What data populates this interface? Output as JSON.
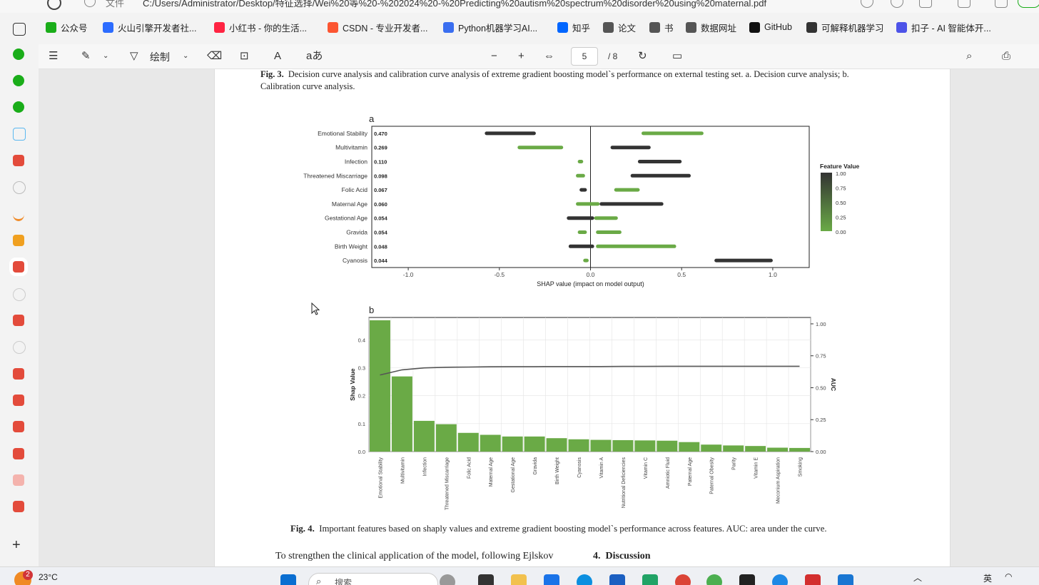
{
  "browser": {
    "file_label": "文件",
    "url": "C:/Users/Administrator/Desktop/特征选择/Wei%20等%20-%202024%20-%20Predicting%20autism%20spectrum%20disorder%20using%20maternal.pdf"
  },
  "bookmarks": [
    {
      "label": "公众号",
      "color": "#1aad19"
    },
    {
      "label": "火山引擎开发者社...",
      "color": "#2c6cff"
    },
    {
      "label": "小红书 - 你的生活...",
      "color": "#ff2442"
    },
    {
      "label": "CSDN - 专业开发者...",
      "color": "#fc5531"
    },
    {
      "label": "Python机器学习AI...",
      "color": "#3a6ef0"
    },
    {
      "label": "知乎",
      "color": "#0066ff"
    },
    {
      "label": "论文",
      "color": "#555555"
    },
    {
      "label": "书",
      "color": "#555555"
    },
    {
      "label": "数据网址",
      "color": "#555555"
    },
    {
      "label": "GitHub",
      "color": "#111111"
    },
    {
      "label": "可解释机器学习",
      "color": "#333333"
    },
    {
      "label": "扣子 - AI 智能体开...",
      "color": "#4d53e8"
    }
  ],
  "toolbar": {
    "draw_label": "绘制",
    "current_page": "5",
    "total_pages": "/ 8"
  },
  "paper": {
    "fig3_caption_label": "Fig. 3.",
    "fig3_caption_text": "Decision curve analysis and calibration curve analysis of extreme gradient boosting model`s performance on external testing set. a. Decision curve analysis; b.",
    "fig3_caption_text2": "Calibration curve analysis.",
    "fig4_caption_label": "Fig. 4.",
    "fig4_caption_text": "Important features based on shaply values and extreme gradient boosting model`s performance across features. AUC: area under the curve.",
    "body_left": "To strengthen the clinical application of the model, following Ejlskov",
    "section_num": "4.",
    "section_title": "Discussion"
  },
  "chart_data": [
    {
      "type": "scatter",
      "panel": "a",
      "xlabel": "SHAP value (impact on model output)",
      "xlim": [
        -1.2,
        1.2
      ],
      "xticks": [
        "-1.0",
        "-0.5",
        "0.0",
        "0.5",
        "1.0"
      ],
      "legend_title": "Feature Value",
      "legend_ticks": [
        "1.00",
        "0.75",
        "0.50",
        "0.25",
        "0.00"
      ],
      "legend_position": "right",
      "colors": {
        "high": "#333333",
        "low": "#6aaa46"
      },
      "features": [
        {
          "name": "Emotional Stability",
          "importance": "0.470",
          "segments": [
            {
              "from": -0.58,
              "to": -0.3,
              "value": "high"
            },
            {
              "from": 0.28,
              "to": 0.62,
              "value": "low"
            }
          ]
        },
        {
          "name": "Multivitamin",
          "importance": "0.269",
          "segments": [
            {
              "from": -0.4,
              "to": -0.15,
              "value": "low"
            },
            {
              "from": 0.11,
              "to": 0.33,
              "value": "high"
            }
          ]
        },
        {
          "name": "Infection",
          "importance": "0.110",
          "segments": [
            {
              "from": -0.07,
              "to": -0.04,
              "value": "low"
            },
            {
              "from": 0.26,
              "to": 0.5,
              "value": "high"
            }
          ]
        },
        {
          "name": "Threatened Miscarriage",
          "importance": "0.098",
          "segments": [
            {
              "from": -0.08,
              "to": -0.03,
              "value": "low"
            },
            {
              "from": 0.22,
              "to": 0.55,
              "value": "high"
            }
          ]
        },
        {
          "name": "Folic Acid",
          "importance": "0.067",
          "segments": [
            {
              "from": -0.06,
              "to": -0.02,
              "value": "high"
            },
            {
              "from": 0.13,
              "to": 0.27,
              "value": "low"
            }
          ]
        },
        {
          "name": "Maternal Age",
          "importance": "0.060",
          "segments": [
            {
              "from": -0.08,
              "to": 0.05,
              "value": "low"
            },
            {
              "from": 0.05,
              "to": 0.4,
              "value": "high"
            }
          ]
        },
        {
          "name": "Gestational Age",
          "importance": "0.054",
          "segments": [
            {
              "from": -0.13,
              "to": 0.02,
              "value": "high"
            },
            {
              "from": 0.02,
              "to": 0.15,
              "value": "low"
            }
          ]
        },
        {
          "name": "Gravida",
          "importance": "0.054",
          "segments": [
            {
              "from": -0.07,
              "to": -0.02,
              "value": "low"
            },
            {
              "from": 0.03,
              "to": 0.17,
              "value": "low"
            }
          ]
        },
        {
          "name": "Birth Weight",
          "importance": "0.048",
          "segments": [
            {
              "from": -0.12,
              "to": 0.02,
              "value": "high"
            },
            {
              "from": 0.03,
              "to": 0.47,
              "value": "low"
            }
          ]
        },
        {
          "name": "Cyanosis",
          "importance": "0.044",
          "segments": [
            {
              "from": -0.04,
              "to": -0.01,
              "value": "low"
            },
            {
              "from": 0.68,
              "to": 1.0,
              "value": "high"
            }
          ]
        }
      ]
    },
    {
      "type": "bar",
      "panel": "b",
      "ylabel": "Shap Value",
      "y2label": "AUC",
      "ylim": [
        0,
        0.48
      ],
      "y2lim": [
        0,
        1.05
      ],
      "yticks": [
        "0.0",
        "0.1",
        "0.2",
        "0.3",
        "0.4"
      ],
      "y2ticks": [
        "0.00",
        "0.25",
        "0.50",
        "0.75",
        "1.00"
      ],
      "bar_color": "#6aaa46",
      "line_color": "#555555",
      "categories": [
        "Emotional Stability",
        "Multivitamin",
        "Infection",
        "Threatened Miscarriage",
        "Folic Acid",
        "Maternal Age",
        "Gestational Age",
        "Gravida",
        "Birth Weight",
        "Cyanosis",
        "Vitamin A",
        "Nutritional Deficiencies",
        "Vitamin C",
        "Amniotic Fluid",
        "Paternal Age",
        "Paternal Obesity",
        "Parity",
        "Vitamin E",
        "Meconium Aspiration",
        "Smoking"
      ],
      "values": [
        0.47,
        0.269,
        0.11,
        0.098,
        0.067,
        0.06,
        0.054,
        0.054,
        0.048,
        0.044,
        0.042,
        0.041,
        0.04,
        0.039,
        0.034,
        0.025,
        0.022,
        0.02,
        0.014,
        0.013
      ],
      "auc": [
        0.6,
        0.64,
        0.655,
        0.66,
        0.662,
        0.664,
        0.665,
        0.665,
        0.666,
        0.666,
        0.666,
        0.667,
        0.667,
        0.668,
        0.668,
        0.668,
        0.668,
        0.668,
        0.668,
        0.668
      ]
    }
  ],
  "system": {
    "weather_badge": "2",
    "temperature": "23°C",
    "search_placeholder": "搜索",
    "ime": "英"
  }
}
